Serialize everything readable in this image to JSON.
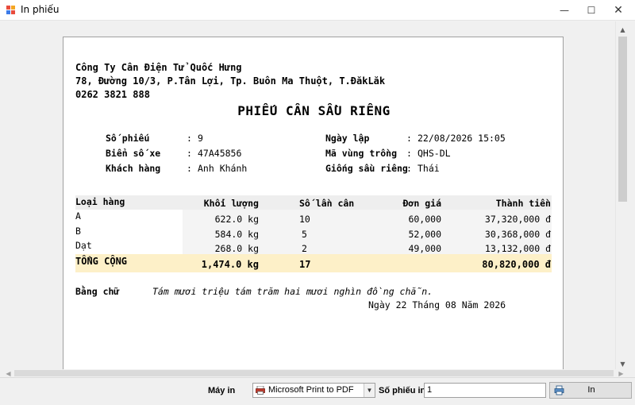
{
  "window": {
    "title": "In phiếu",
    "minimize": "—",
    "maximize": "☐",
    "close": "✕"
  },
  "company": {
    "name": "Công Ty Cân Điện Tử Quốc Hưng",
    "address": "78, Đường 10/3, P.Tân Lợi, Tp. Buôn Ma Thuột, T.ĐăkLăk",
    "phone": "0262 3821 888"
  },
  "doc_title": "PHIẾU CÂN SẦU RIÊNG",
  "info": {
    "left": [
      {
        "label": "Số phiếu",
        "value": "9"
      },
      {
        "label": "Biển số xe",
        "value": "47A45856"
      },
      {
        "label": "Khách hàng",
        "value": "Anh Khánh"
      }
    ],
    "right": [
      {
        "label": "Ngày lập",
        "value": "22/08/2026 15:05"
      },
      {
        "label": "Mã vùng trồng",
        "value": "QHS-DL"
      },
      {
        "label": "Giống sầu riêng",
        "value": "Thái"
      }
    ],
    "colon": ":"
  },
  "table": {
    "headers": [
      "Loại hàng",
      "Khối lượng",
      "Số lần cân",
      "Đơn giá",
      "Thành tiền"
    ],
    "rows": [
      [
        "A",
        "622.0 kg",
        "10",
        "60,000",
        "37,320,000 đ"
      ],
      [
        "B",
        "584.0 kg",
        "5",
        "52,000",
        "30,368,000 đ"
      ],
      [
        "Dạt",
        "268.0 kg",
        "2",
        "49,000",
        "13,132,000 đ"
      ]
    ],
    "total": {
      "label": "TỔNG CỘNG",
      "weight": "1,474.0 kg",
      "count": "17",
      "amount": "80,820,000 đ"
    }
  },
  "in_words": {
    "label": "Bằng chữ",
    "value": "Tám mươi triệu tám trăm hai mươi nghìn đồng chẵn."
  },
  "date_line": "Ngày 22 Tháng 08 Năm 2026",
  "toolbar": {
    "printer_label": "Máy in",
    "printer_value": "Microsoft Print to PDF",
    "copies_label": "Số phiếu in",
    "copies_value": "1",
    "print_label": "In"
  }
}
